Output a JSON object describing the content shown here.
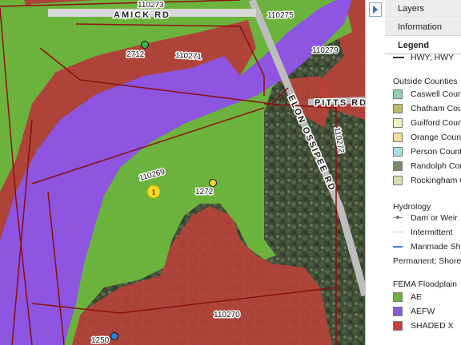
{
  "map": {
    "labels": {
      "amick_rd": "AMICK RD",
      "pitts_rd": "PITTS RD",
      "elon_ossipee_rd": "ELON OSSIPEE RD",
      "p110273": "110273",
      "p110275": "110275",
      "p110271": "110271",
      "p110279": "110279",
      "p110272": "110272",
      "p110269": "110269",
      "p110270": "110270",
      "pt2712": "2712",
      "pt1272": "1272",
      "pt1250": "1250",
      "marker_1": "1"
    }
  },
  "panel": {
    "tabs": [
      {
        "label": "Layers"
      },
      {
        "label": "Information"
      },
      {
        "label": "Legend"
      }
    ],
    "legend": {
      "top_item": "HWY; HWY",
      "outside_counties_header": "Outside Counties",
      "counties": [
        {
          "label": "Caswell County",
          "color": "#8fd1a8"
        },
        {
          "label": "Chatham County",
          "color": "#bdb86a"
        },
        {
          "label": "Guilford County",
          "color": "#f0f4c0"
        },
        {
          "label": "Orange County",
          "color": "#f7dba0"
        },
        {
          "label": "Person County",
          "color": "#a8e0e0"
        },
        {
          "label": "Randolph County",
          "color": "#7c8a6a"
        },
        {
          "label": "Rockingham County",
          "color": "#d7dfb0"
        }
      ],
      "hydrology_header": "Hydrology",
      "hydrology": [
        {
          "label": "Dam or Weir",
          "icon": "dam-line-icon"
        },
        {
          "label": "Intermittent",
          "icon": "dashed-line-icon"
        },
        {
          "label": "Manmade Shoreline",
          "icon": "solid-line-icon"
        }
      ],
      "permanent": "Permanent; Shoreline",
      "fema_header": "FEMA Floodplain",
      "fema": [
        {
          "label": "AE",
          "color": "#6fb23e"
        },
        {
          "label": "AEFW",
          "color": "#8a5ad8"
        },
        {
          "label": "SHADED X",
          "color": "#c8403c"
        }
      ]
    }
  }
}
